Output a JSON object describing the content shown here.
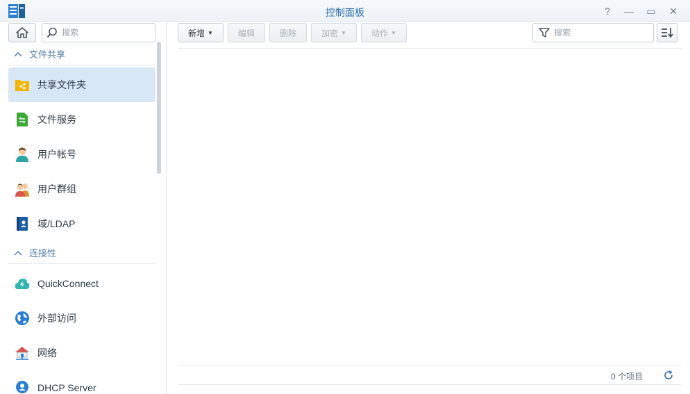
{
  "window": {
    "title": "控制面板",
    "help_glyph": "?",
    "minimize_glyph": "—",
    "maximize_glyph": "▭",
    "close_glyph": "✕"
  },
  "sidebar": {
    "search_placeholder": "搜索",
    "sections": [
      {
        "label": "文件共享"
      },
      {
        "label": "连接性"
      }
    ],
    "items": [
      {
        "label": "共享文件夹",
        "icon": "shared-folder-icon",
        "active": true
      },
      {
        "label": "文件服务",
        "icon": "file-services-icon"
      },
      {
        "label": "用户帐号",
        "icon": "user-icon"
      },
      {
        "label": "用户群组",
        "icon": "group-icon"
      },
      {
        "label": "域/LDAP",
        "icon": "domain-ldap-icon"
      },
      {
        "label": "QuickConnect",
        "icon": "quickconnect-icon"
      },
      {
        "label": "外部访问",
        "icon": "external-access-icon"
      },
      {
        "label": "网络",
        "icon": "network-icon"
      },
      {
        "label": "DHCP Server",
        "icon": "dhcp-server-icon"
      }
    ]
  },
  "toolbar": {
    "create_label": "新增",
    "edit_label": "编辑",
    "delete_label": "删除",
    "encrypt_label": "加密",
    "action_label": "动作",
    "search_placeholder": "搜索"
  },
  "footer": {
    "count_text": "0 个项目"
  },
  "colors": {
    "accent": "#2b6fb0",
    "active_row": "#d8e7f6",
    "section_text": "#4e7ba8"
  }
}
